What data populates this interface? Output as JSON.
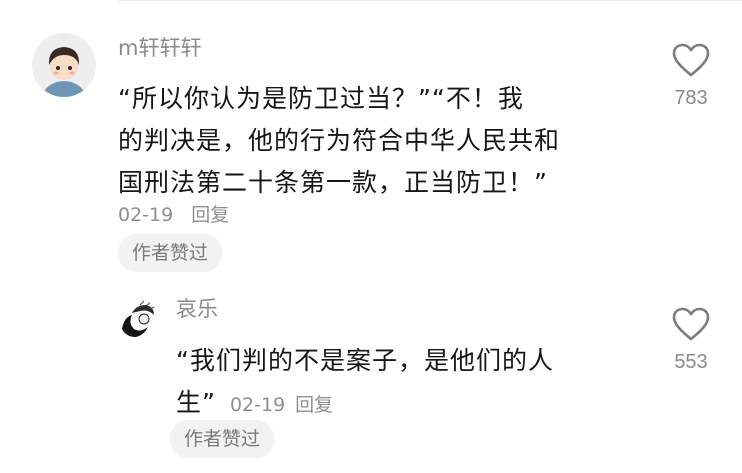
{
  "comments": [
    {
      "username": "m轩轩轩",
      "text_line1": "“所以你认为是防卫过当？”“不！我",
      "text_line2": "的判决是，他的行为符合中华人民共和",
      "text_line3": "国刑法第二十条第一款，正当防卫！”",
      "date": "02-19",
      "reply_label": "回复",
      "badge": "作者赞过",
      "likes": "783"
    },
    {
      "username": "哀乐",
      "text_line1": "“我们判的不是案子，是他们的人",
      "text_line2": "生”",
      "date": "02-19",
      "reply_label": "回复",
      "badge": "作者赞过",
      "likes": "553"
    }
  ]
}
